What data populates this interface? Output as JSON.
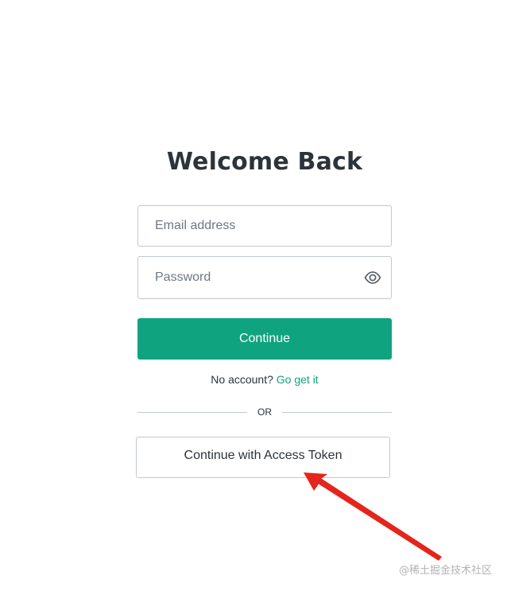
{
  "page": {
    "title": "Welcome Back"
  },
  "form": {
    "email_placeholder": "Email address",
    "password_placeholder": "Password",
    "password_icon": "eye-icon",
    "continue_label": "Continue",
    "signup_prompt": "No account?",
    "signup_link": "Go get it",
    "divider_text": "OR",
    "token_button_label": "Continue with Access Token"
  },
  "annotation": {
    "arrow_color": "#e5241b"
  },
  "watermark": {
    "text": "@稀土掘金技术社区"
  },
  "colors": {
    "accent": "#10a37f",
    "text": "#2d333a",
    "border": "#c2c8d0"
  }
}
